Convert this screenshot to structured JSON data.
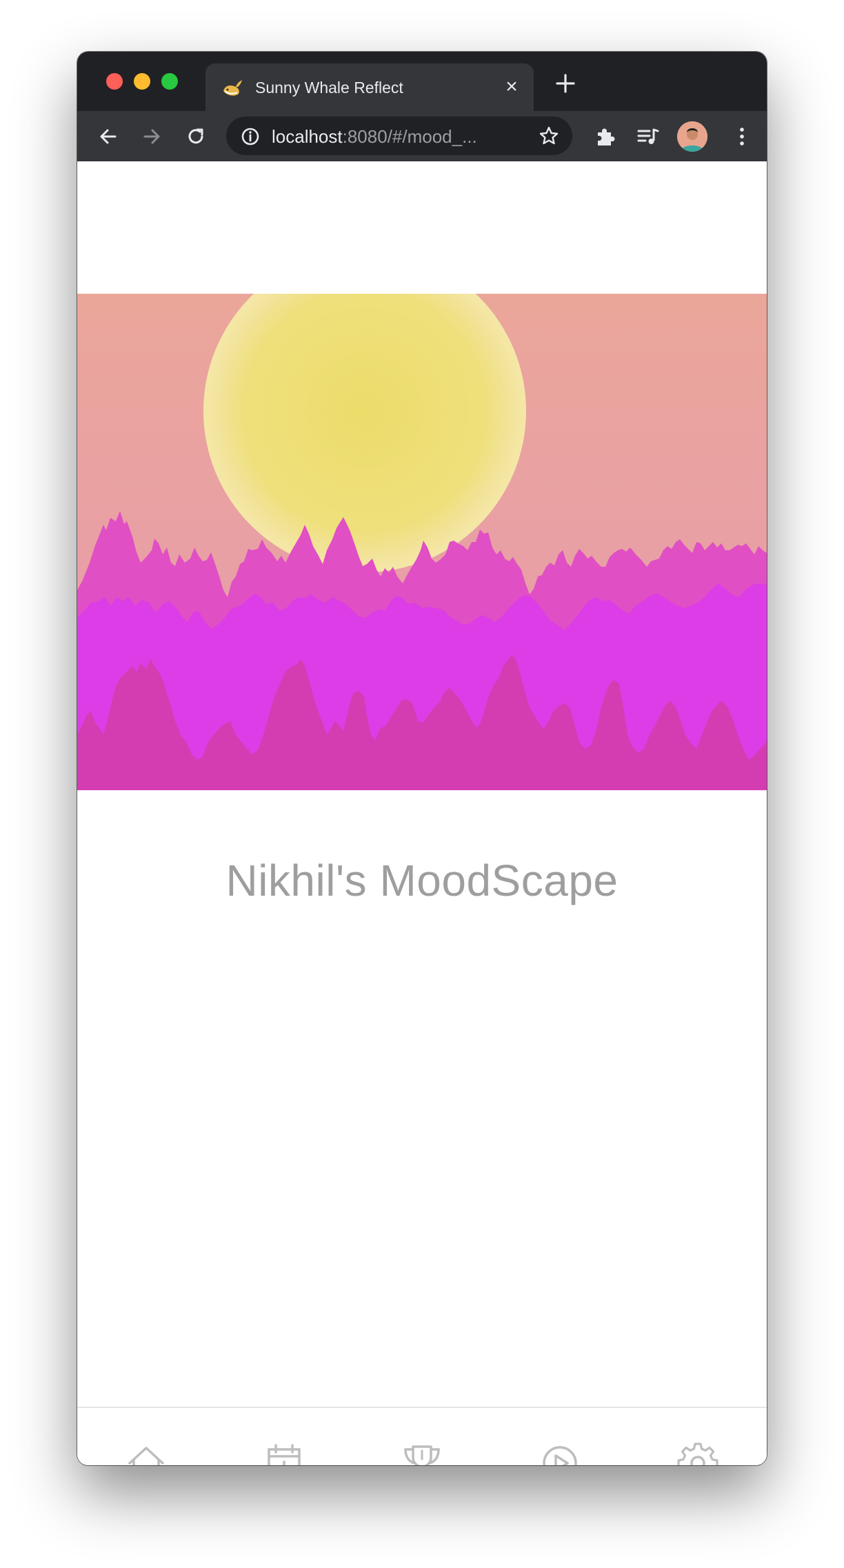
{
  "browser": {
    "tab_title": "Sunny Whale Reflect",
    "tab_close_label": "×",
    "url_host": "localhost",
    "url_rest": ":8080/#/mood_...",
    "icons": {
      "back": "arrow-left-icon",
      "forward": "arrow-right-icon",
      "reload": "reload-icon",
      "site_info": "info-icon",
      "bookmark": "star-icon",
      "extensions": "puzzle-icon",
      "media": "media-queue-icon",
      "menu": "kebab-menu-icon"
    }
  },
  "page": {
    "title": "Nikhil's MoodScape",
    "scene_colors": {
      "sky_top": "#eba69a",
      "sky_bottom": "#e79fb0",
      "sun": "#ecdc6a",
      "sun_edge": "#f5e7a8",
      "mountain_back": "#e050c4",
      "mountain_mid": "#dc3de4",
      "mountain_front": "#d63bb0"
    }
  },
  "bottom_nav": {
    "items": [
      {
        "name": "home",
        "icon": "home-icon"
      },
      {
        "name": "add-entry",
        "icon": "calendar-plus-icon"
      },
      {
        "name": "achievements",
        "icon": "trophy-icon"
      },
      {
        "name": "play",
        "icon": "play-circle-icon"
      },
      {
        "name": "settings",
        "icon": "gear-icon"
      }
    ],
    "icon_color": "#bdbdbd"
  }
}
